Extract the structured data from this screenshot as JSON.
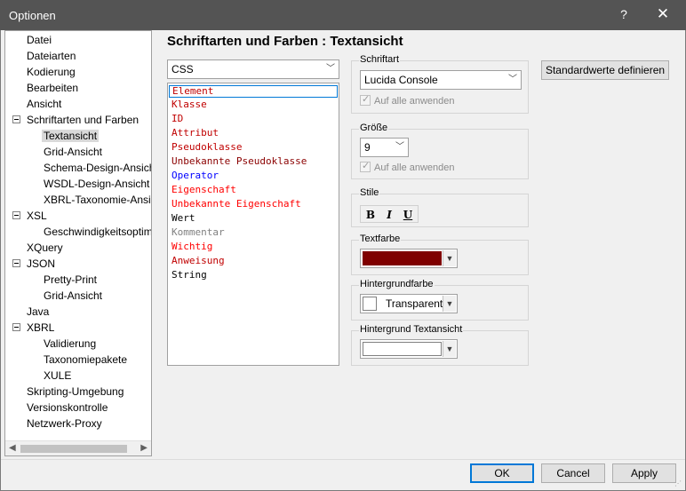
{
  "window": {
    "title": "Optionen",
    "help_glyph": "?",
    "close_glyph": "✕"
  },
  "tree": {
    "items": [
      {
        "label": "Datei",
        "level": 0,
        "expander": false
      },
      {
        "label": "Dateiarten",
        "level": 0,
        "expander": false
      },
      {
        "label": "Kodierung",
        "level": 0,
        "expander": false
      },
      {
        "label": "Bearbeiten",
        "level": 0,
        "expander": false
      },
      {
        "label": "Ansicht",
        "level": 0,
        "expander": false
      },
      {
        "label": "Schriftarten und Farben",
        "level": 0,
        "expander": true
      },
      {
        "label": "Textansicht",
        "level": 1,
        "expander": false,
        "selected": true
      },
      {
        "label": "Grid-Ansicht",
        "level": 1,
        "expander": false
      },
      {
        "label": "Schema-Design-Ansicht",
        "level": 1,
        "expander": false
      },
      {
        "label": "WSDL-Design-Ansicht",
        "level": 1,
        "expander": false
      },
      {
        "label": "XBRL-Taxonomie-Ansicht",
        "level": 1,
        "expander": false
      },
      {
        "label": "XSL",
        "level": 0,
        "expander": true
      },
      {
        "label": "Geschwindigkeitsoptimierungen",
        "level": 1,
        "expander": false
      },
      {
        "label": "XQuery",
        "level": 0,
        "expander": false
      },
      {
        "label": "JSON",
        "level": 0,
        "expander": true
      },
      {
        "label": "Pretty-Print",
        "level": 1,
        "expander": false
      },
      {
        "label": "Grid-Ansicht",
        "level": 1,
        "expander": false
      },
      {
        "label": "Java",
        "level": 0,
        "expander": false
      },
      {
        "label": "XBRL",
        "level": 0,
        "expander": true
      },
      {
        "label": "Validierung",
        "level": 1,
        "expander": false
      },
      {
        "label": "Taxonomiepakete",
        "level": 1,
        "expander": false
      },
      {
        "label": "XULE",
        "level": 1,
        "expander": false
      },
      {
        "label": "Skripting-Umgebung",
        "level": 0,
        "expander": false
      },
      {
        "label": "Versionskontrolle",
        "level": 0,
        "expander": false
      },
      {
        "label": "Netzwerk-Proxy",
        "level": 0,
        "expander": false
      }
    ],
    "scroll_left_glyph": "◀",
    "scroll_right_glyph": "▶"
  },
  "main": {
    "heading": "Schriftarten und Farben : Textansicht",
    "language_select": "CSS",
    "elements": [
      {
        "label": "Element",
        "color": "#c00000"
      },
      {
        "label": "Klasse",
        "color": "#c00000"
      },
      {
        "label": "ID",
        "color": "#c00000"
      },
      {
        "label": "Attribut",
        "color": "#c00000"
      },
      {
        "label": "Pseudoklasse",
        "color": "#c00000"
      },
      {
        "label": "Unbekannte Pseudoklasse",
        "color": "#8b0000"
      },
      {
        "label": "Operator",
        "color": "#0000ff"
      },
      {
        "label": "Eigenschaft",
        "color": "#ff0000"
      },
      {
        "label": "Unbekannte Eigenschaft",
        "color": "#ff0000"
      },
      {
        "label": "Wert",
        "color": "#000000"
      },
      {
        "label": "Kommentar",
        "color": "#808080"
      },
      {
        "label": "Wichtig",
        "color": "#ff0000"
      },
      {
        "label": "Anweisung",
        "color": "#c00000"
      },
      {
        "label": "String",
        "color": "#000000"
      }
    ],
    "font_group": {
      "label": "Schriftart",
      "value": "Lucida Console",
      "apply_all": "Auf alle anwenden"
    },
    "size_group": {
      "label": "Größe",
      "value": "9",
      "apply_all": "Auf alle anwenden"
    },
    "style_group": {
      "label": "Stile",
      "bold": "B",
      "italic": "I",
      "underline": "U"
    },
    "text_color_group": {
      "label": "Textfarbe",
      "color": "#7f0000"
    },
    "bg_color_group": {
      "label": "Hintergrundfarbe",
      "value": "Transparent"
    },
    "bg_textview_group": {
      "label": "Hintergrund Textansicht",
      "color": "#ffffff"
    },
    "reset_button": "Standardwerte definieren"
  },
  "footer": {
    "ok": "OK",
    "cancel": "Cancel",
    "apply": "Apply"
  }
}
